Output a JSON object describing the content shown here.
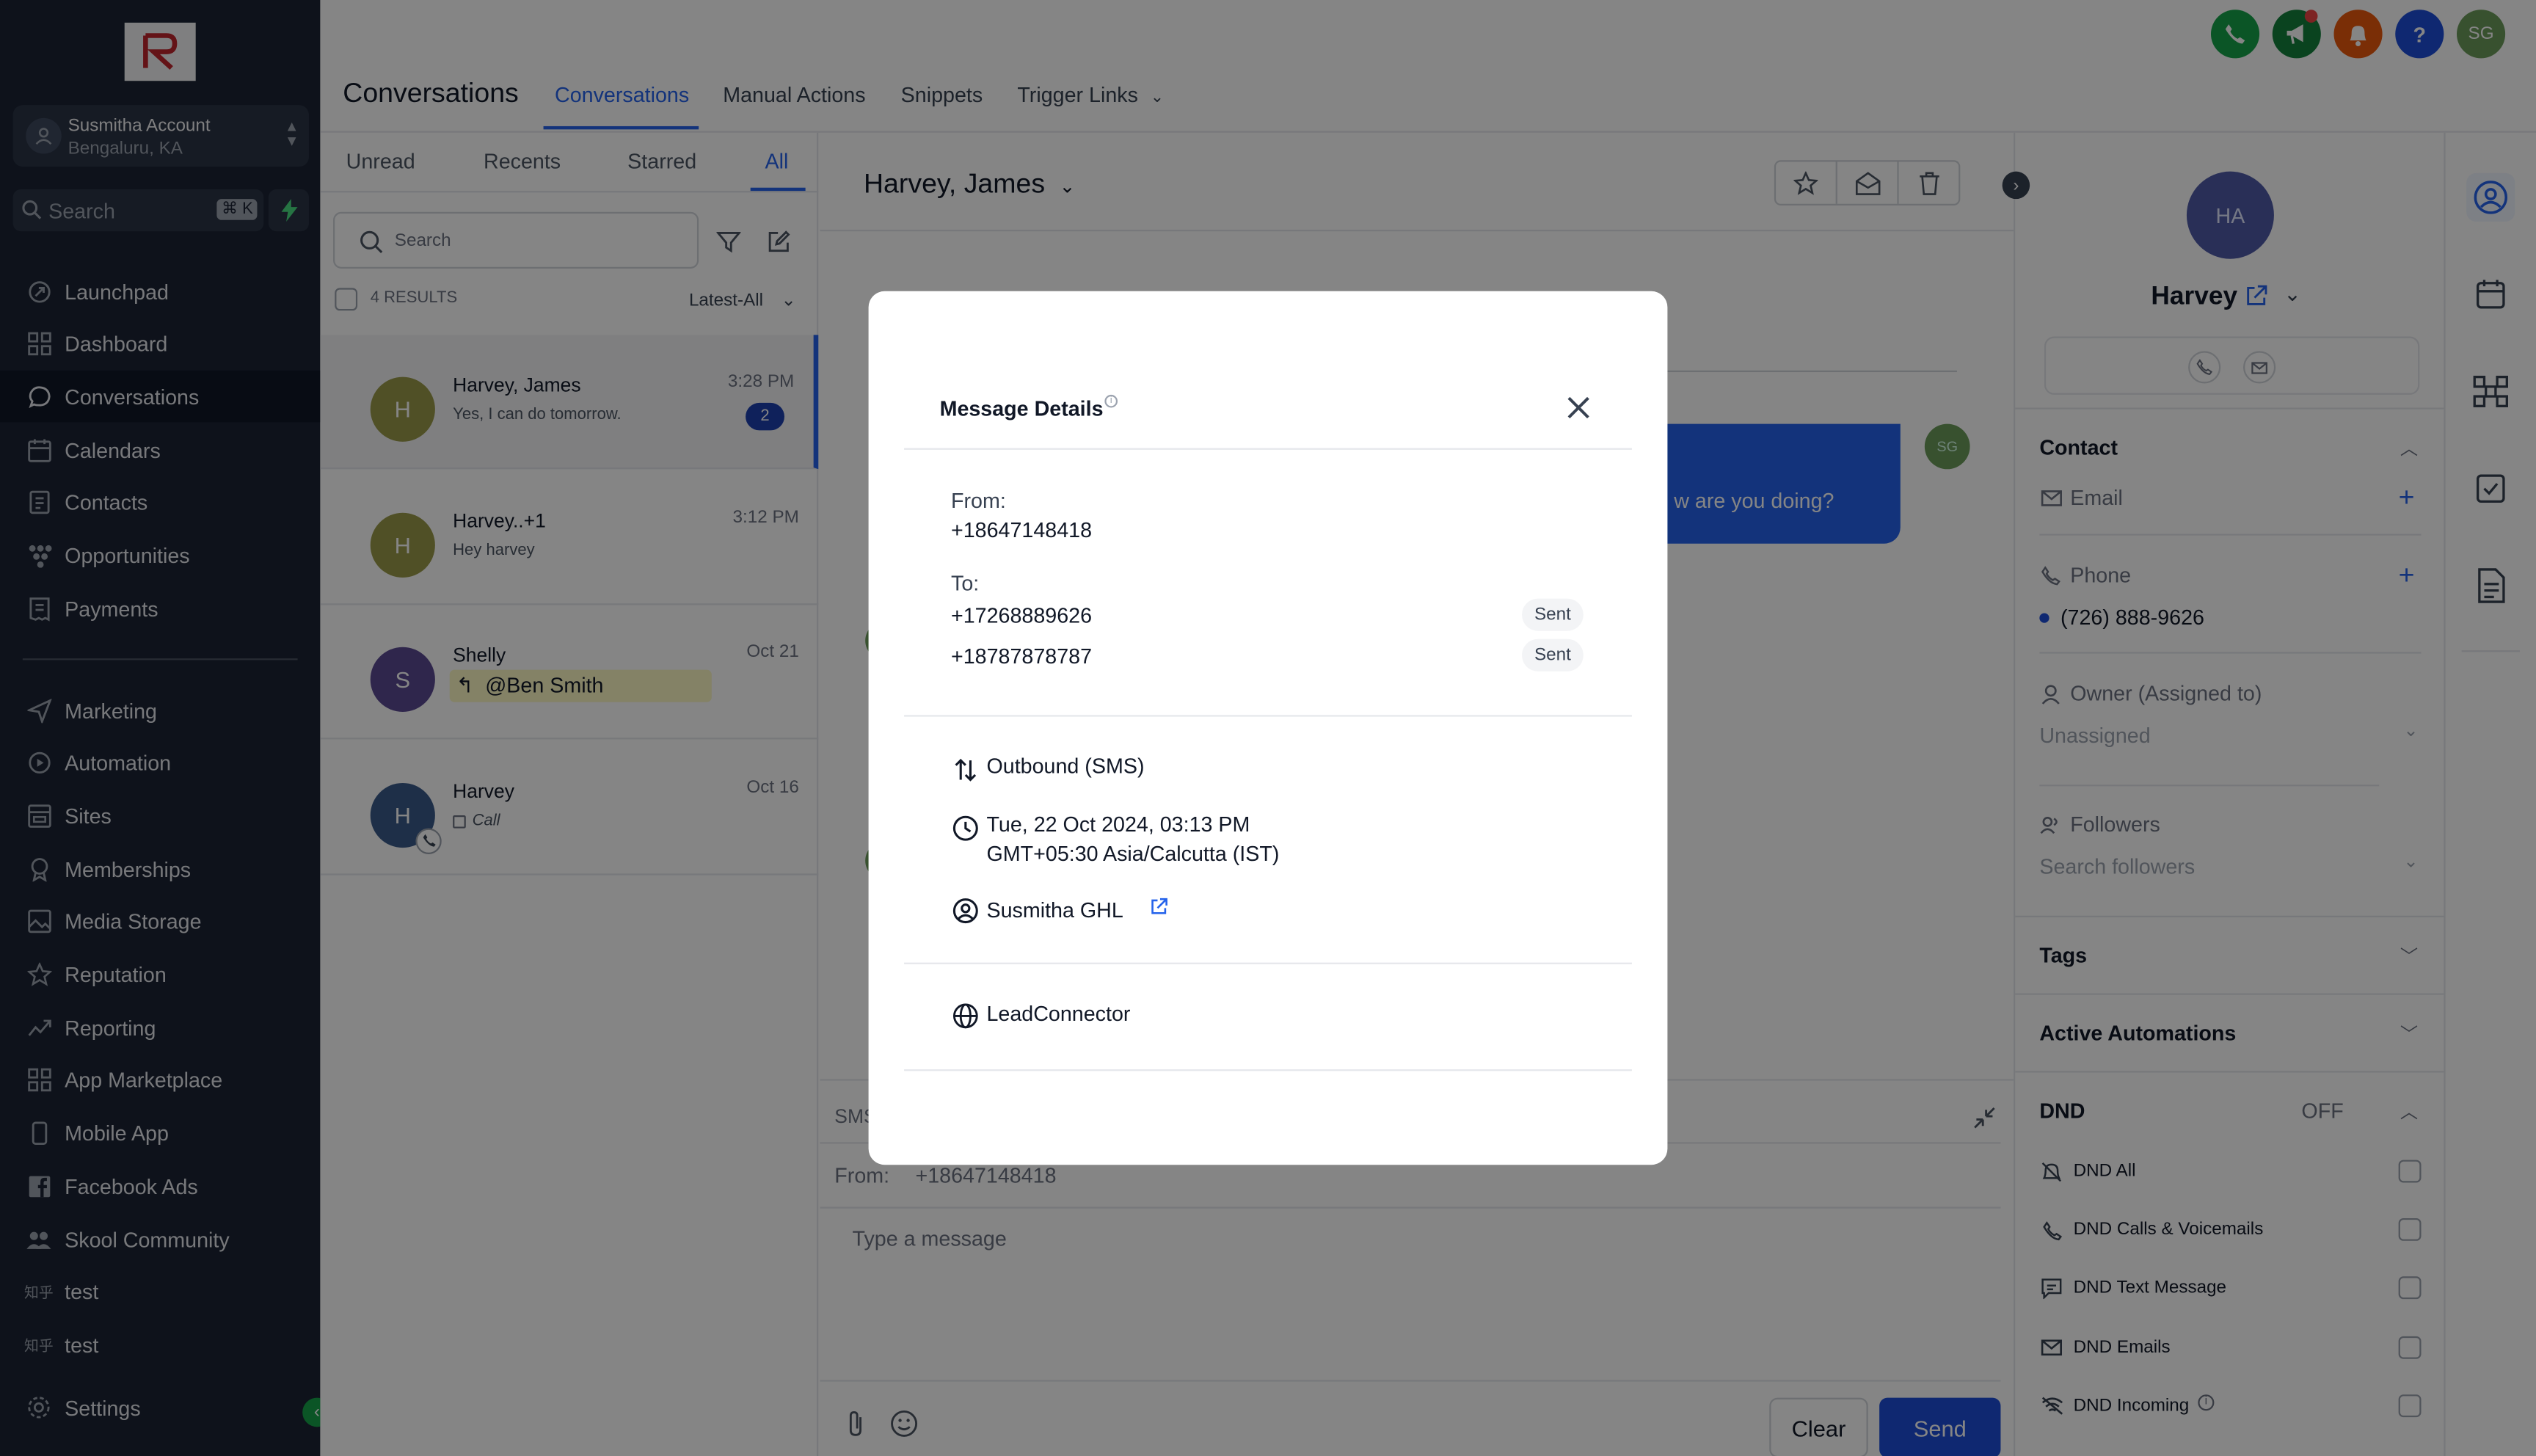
{
  "sidebar": {
    "account_name": "Susmitha Account",
    "account_location": "Bengaluru, KA",
    "search_placeholder": "Search",
    "search_shortcut": "⌘ K",
    "items_top": [
      {
        "label": "Launchpad",
        "icon": "rocket-icon"
      },
      {
        "label": "Dashboard",
        "icon": "grid-icon"
      },
      {
        "label": "Conversations",
        "icon": "chat-icon"
      },
      {
        "label": "Calendars",
        "icon": "calendar-icon"
      },
      {
        "label": "Contacts",
        "icon": "contacts-icon"
      },
      {
        "label": "Opportunities",
        "icon": "funnel-icon"
      },
      {
        "label": "Payments",
        "icon": "receipt-icon"
      }
    ],
    "items_bottom": [
      {
        "label": "Marketing",
        "icon": "send-icon"
      },
      {
        "label": "Automation",
        "icon": "automation-icon"
      },
      {
        "label": "Sites",
        "icon": "globe-icon"
      },
      {
        "label": "Memberships",
        "icon": "badge-icon"
      },
      {
        "label": "Media Storage",
        "icon": "image-icon"
      },
      {
        "label": "Reputation",
        "icon": "star-icon"
      },
      {
        "label": "Reporting",
        "icon": "trend-icon"
      },
      {
        "label": "App Marketplace",
        "icon": "apps-icon"
      },
      {
        "label": "Mobile App",
        "icon": "mobile-icon"
      },
      {
        "label": "Facebook Ads",
        "icon": "facebook-icon"
      },
      {
        "label": "Skool Community",
        "icon": "people-icon"
      },
      {
        "label": "test",
        "icon": "custom-link-icon",
        "icon_text": "知乎"
      },
      {
        "label": "test",
        "icon": "custom-link-icon",
        "icon_text": "知乎"
      }
    ],
    "settings_label": "Settings",
    "active": "Conversations"
  },
  "header": {
    "title": "Conversations",
    "tabs": [
      {
        "label": "Conversations",
        "active": true
      },
      {
        "label": "Manual Actions"
      },
      {
        "label": "Snippets"
      },
      {
        "label": "Trigger Links"
      }
    ],
    "user_initials": "SG"
  },
  "conversation_list": {
    "tabs": [
      "Unread",
      "Recents",
      "Starred",
      "All"
    ],
    "active_tab": "All",
    "search_placeholder": "Search",
    "results": "4 RESULTS",
    "sort": "Latest-All",
    "items": [
      {
        "initial": "H",
        "name": "Harvey, James",
        "preview": "Yes, I can do tomorrow.",
        "time": "3:28 PM",
        "unread": "2",
        "color": "#9a9a4a"
      },
      {
        "initial": "H",
        "name": "Harvey..+1",
        "preview": "Hey harvey",
        "time": "3:12 PM",
        "color": "#9a9a4a"
      },
      {
        "initial": "S",
        "name": "Shelly",
        "preview": "@Ben Smith",
        "time": "Oct 21",
        "color": "#5b4a92"
      },
      {
        "initial": "H",
        "name": "Harvey",
        "preview": "Call",
        "time": "Oct 16",
        "color": "#3b5a8a"
      }
    ]
  },
  "chat": {
    "contact_name": "Harvey, James",
    "bubble_text": "w are you doing?",
    "bubble_initials": "SG",
    "channel": "SMS",
    "from_label": "From:",
    "from_number": "+18647148418",
    "message_placeholder": "Type a message",
    "clear_label": "Clear",
    "send_label": "Send"
  },
  "contact_panel": {
    "initials": "HA",
    "name": "Harvey",
    "contact_section": "Contact",
    "email_label": "Email",
    "phone_label": "Phone",
    "phone_value": "(726) 888-9626",
    "owner_label": "Owner (Assigned to)",
    "owner_value": "Unassigned",
    "followers_label": "Followers",
    "followers_placeholder": "Search followers",
    "tags_section": "Tags",
    "automations_section": "Active Automations",
    "dnd_section": "DND",
    "dnd_status": "OFF",
    "dnd_items": [
      {
        "label": "DND All",
        "icon": "bell-off-icon"
      },
      {
        "label": "DND Calls & Voicemails",
        "icon": "phone-icon"
      },
      {
        "label": "DND Text Message",
        "icon": "message-icon"
      },
      {
        "label": "DND Emails",
        "icon": "mail-icon"
      },
      {
        "label": "DND Incoming",
        "icon": "wifi-off-icon"
      }
    ]
  },
  "modal": {
    "title": "Message Details",
    "from_label": "From:",
    "from_number": "+18647148418",
    "to_label": "To:",
    "recipients": [
      {
        "number": "+17268889626",
        "status": "Sent"
      },
      {
        "number": "+18787878787",
        "status": "Sent"
      }
    ],
    "direction": "Outbound (SMS)",
    "datetime": "Tue, 22 Oct 2024, 03:13 PM",
    "timezone": "GMT+05:30 Asia/Calcutta (IST)",
    "user": "Susmitha GHL",
    "source": "LeadConnector"
  },
  "colors": {
    "accent": "#2563eb",
    "sidebar_bg": "#1c2434",
    "send_button": "#1d4ed8",
    "green": "#16a34a"
  }
}
